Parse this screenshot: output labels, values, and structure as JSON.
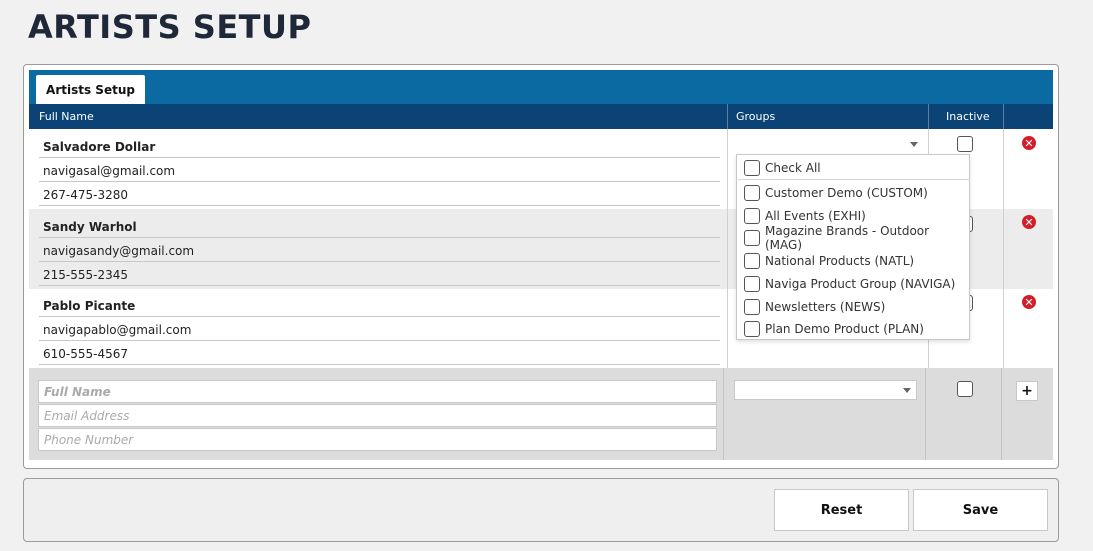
{
  "page": {
    "title": "ARTISTS SETUP"
  },
  "tab": {
    "label": "Artists Setup"
  },
  "columns": {
    "full_name": "Full Name",
    "groups": "Groups",
    "inactive": "Inactive"
  },
  "rows": [
    {
      "name": "Salvadore Dollar",
      "email": "navigasal@gmail.com",
      "phone": "267-475-3280"
    },
    {
      "name": "Sandy Warhol",
      "email": "navigasandy@gmail.com",
      "phone": "215-555-2345"
    },
    {
      "name": "Pablo Picante",
      "email": "navigapablo@gmail.com",
      "phone": "610-555-4567"
    }
  ],
  "new_row": {
    "name_placeholder": "Full Name",
    "email_placeholder": "Email Address",
    "phone_placeholder": "Phone Number",
    "add_label": "+"
  },
  "groups_dropdown": {
    "check_all": "Check All",
    "options": [
      "Customer Demo (CUSTOM)",
      "All Events (EXHI)",
      "Magazine Brands - Outdoor (MAG)",
      "National Products (NATL)",
      "Naviga Product Group (NAVIGA)",
      "Newsletters (NEWS)",
      "Plan Demo Product (PLAN)"
    ]
  },
  "footer": {
    "reset_label": "Reset",
    "save_label": "Save"
  },
  "colors": {
    "tab_bar": "#0a6aa1",
    "header": "#0b4377",
    "delete": "#d11e2a",
    "title": "#1e2838"
  },
  "icons": {
    "delete": "x-circle-icon",
    "dropdown": "chevron-down-icon",
    "add": "plus-icon"
  }
}
